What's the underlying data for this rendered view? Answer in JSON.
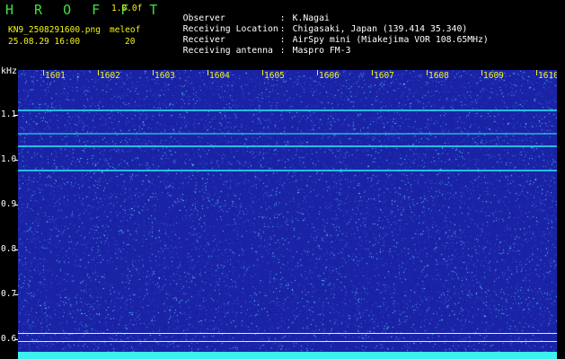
{
  "header": {
    "app_title": "H R O F F T",
    "version": "1.0.0f",
    "filename": "KN9_2508291600.png",
    "meleof_label": "meleof",
    "meleof_value": "20",
    "datetime": "25.08.29 16:00"
  },
  "info": [
    {
      "key": "Observer",
      "value": "K.Nagai"
    },
    {
      "key": "Receiving Location",
      "value": "Chigasaki, Japan (139.414 35.340)"
    },
    {
      "key": "Receiver",
      "value": "AirSpy mini (Miakejima VOR 108.65MHz)"
    },
    {
      "key": "Receiving antenna",
      "value": "Maspro FM-3"
    }
  ],
  "axes": {
    "y_unit": "kHz",
    "x_ticks": [
      "1601",
      "1602",
      "1603",
      "1604",
      "1605",
      "1606",
      "1607",
      "1608",
      "1609",
      "1610"
    ],
    "y_ticks": [
      "1.1",
      "1.0",
      "0.9",
      "0.8",
      "0.7",
      "0.6"
    ]
  },
  "colors": {
    "background": "#1a23a6",
    "signal": "#27d8e8",
    "accent_title": "#3fe03f",
    "label_yellow": "#f4f418"
  }
}
